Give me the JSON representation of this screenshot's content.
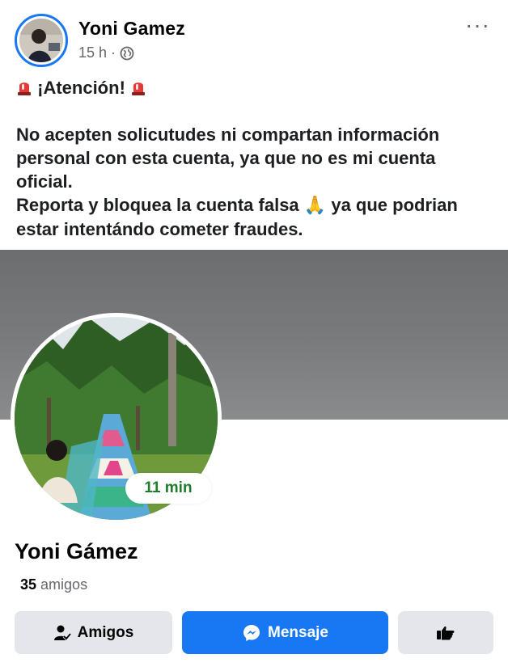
{
  "post": {
    "author": "Yoni Gamez",
    "time": "15 h",
    "separator": "·",
    "privacy_icon": "globe-icon",
    "more_icon": "more-options-icon",
    "more_label": "···",
    "alert_icon": "police-light-emoji",
    "alert_title": "¡Atención!",
    "line1": "No acepten solicutudes ni compartan información personal con esta cuenta, ya que no es mi cuenta oficial.",
    "line2_before": "Reporta y bloquea la cuenta falsa",
    "pray_emoji": "🙏",
    "line2_after": "ya que podrian estar intentándo cometer fraudes."
  },
  "profile": {
    "story_badge": "11 min",
    "name": "Yoni Gámez",
    "friends_number": "35",
    "friends_label": "amigos",
    "buttons": {
      "friends": "Amigos",
      "message": "Mensaje"
    }
  },
  "colors": {
    "accent": "#1877f2",
    "secondary_button": "#e4e6eb",
    "badge_text": "#1d7d2a",
    "cover": "#727375"
  }
}
